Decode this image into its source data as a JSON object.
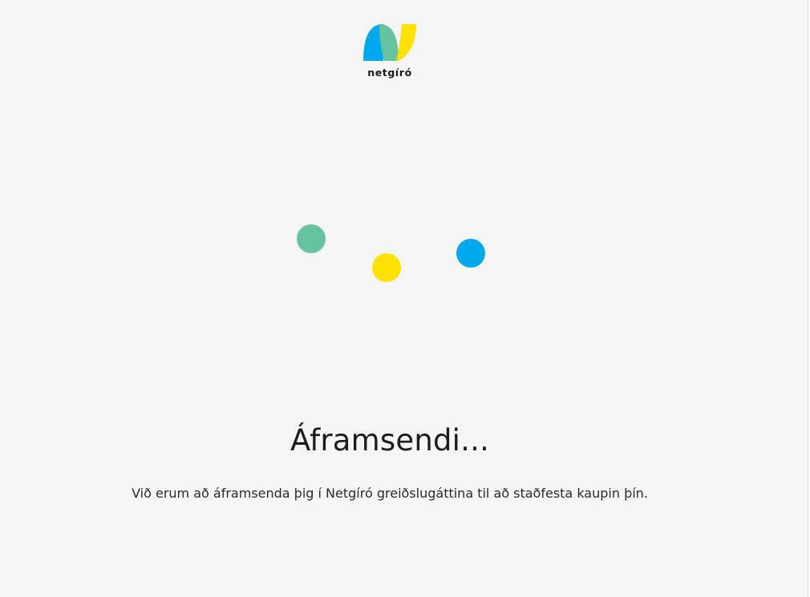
{
  "brand": {
    "name": "netgíró",
    "logo_icon": "netgiro-logo-icon",
    "colors": {
      "blue": "#00a8ec",
      "green": "#66c3a0",
      "yellow": "#ffe100"
    }
  },
  "loader": {
    "icon": "loading-dots",
    "dots": [
      {
        "name": "green",
        "color": "#66c3a0"
      },
      {
        "name": "yellow",
        "color": "#ffe100"
      },
      {
        "name": "blue",
        "color": "#00a8ec"
      }
    ]
  },
  "status": {
    "title": "Áframsendi...",
    "message": "Við erum að áframsenda þig í Netgíró greiðslugáttina til að staðfesta kaupin þín."
  }
}
